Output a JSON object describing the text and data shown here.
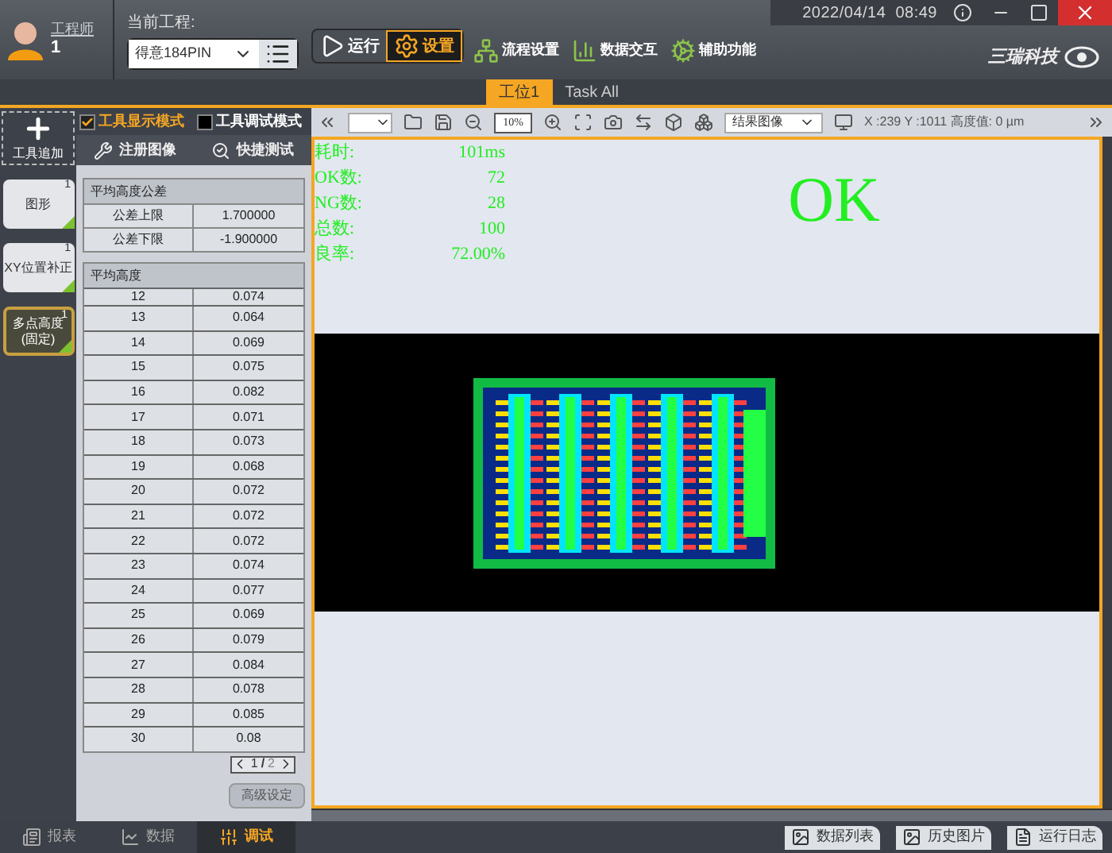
{
  "user": {
    "role": "工程师",
    "id": "1"
  },
  "project": {
    "label": "当前工程:",
    "value": "得意184PIN"
  },
  "mode_buttons": [
    {
      "kind": "run",
      "label": "运行",
      "selected": false
    },
    {
      "kind": "settings",
      "label": "设置",
      "selected": true
    }
  ],
  "nav": [
    {
      "kind": "flow",
      "label": "流程设置"
    },
    {
      "kind": "data",
      "label": "数据交互"
    },
    {
      "kind": "aux",
      "label": "辅助功能"
    }
  ],
  "datetime": "2022/04/14  08:49",
  "logo": "三瑞科技",
  "station_tabs": [
    {
      "label": "工位1",
      "selected": true
    },
    {
      "label": "Task All",
      "selected": false
    }
  ],
  "tool_add": "工具追加",
  "tools": [
    {
      "name": "图形",
      "badge": "1",
      "selected": false
    },
    {
      "name": "XY位置补正",
      "badge": "1",
      "selected": false
    },
    {
      "name": "多点高度(固定)",
      "badge": "1",
      "selected": true
    }
  ],
  "mode_checks": [
    {
      "label": "工具显示模式",
      "checked": true
    },
    {
      "label": "工具调试模式",
      "checked": false
    }
  ],
  "panel_buttons": [
    {
      "kind": "register",
      "label": "注册图像"
    },
    {
      "kind": "test",
      "label": "快捷测试"
    }
  ],
  "tolerance": {
    "title": "平均高度公差",
    "rows": [
      {
        "name": "公差上限",
        "value": "1.700000"
      },
      {
        "name": "公差下限",
        "value": "-1.900000"
      }
    ]
  },
  "heights": {
    "title": "平均高度",
    "rows": [
      [
        "12",
        "0.074"
      ],
      [
        "13",
        "0.064"
      ],
      [
        "14",
        "0.069"
      ],
      [
        "15",
        "0.075"
      ],
      [
        "16",
        "0.082"
      ],
      [
        "17",
        "0.071"
      ],
      [
        "18",
        "0.073"
      ],
      [
        "19",
        "0.068"
      ],
      [
        "20",
        "0.072"
      ],
      [
        "21",
        "0.072"
      ],
      [
        "22",
        "0.072"
      ],
      [
        "23",
        "0.074"
      ],
      [
        "24",
        "0.077"
      ],
      [
        "25",
        "0.069"
      ],
      [
        "26",
        "0.079"
      ],
      [
        "27",
        "0.084"
      ],
      [
        "28",
        "0.078"
      ],
      [
        "29",
        "0.085"
      ],
      [
        "30",
        "0.08"
      ]
    ]
  },
  "pager": {
    "current": "1",
    "separator": "/",
    "total": "2"
  },
  "advanced_button": "高级设定",
  "toolbar": {
    "zoom": "10%",
    "view": "结果图像",
    "coords": "X :239 Y :1011 高度值: 0 µm"
  },
  "stats": [
    {
      "label": "耗时:",
      "value": "101ms"
    },
    {
      "label": "OK数:",
      "value": "72"
    },
    {
      "label": "NG数:",
      "value": "28"
    },
    {
      "label": "总数:",
      "value": "100"
    },
    {
      "label": "良率:",
      "value": "72.00%"
    }
  ],
  "result": "OK",
  "bottom_tabs": [
    {
      "kind": "report",
      "label": "报表",
      "selected": false
    },
    {
      "kind": "data",
      "label": "数据",
      "selected": false
    },
    {
      "kind": "debug",
      "label": "调试",
      "selected": true
    }
  ],
  "bottom_buttons": [
    {
      "kind": "image",
      "label": "数据列表"
    },
    {
      "kind": "image",
      "label": "历史图片"
    },
    {
      "kind": "log",
      "label": "运行日志"
    }
  ]
}
